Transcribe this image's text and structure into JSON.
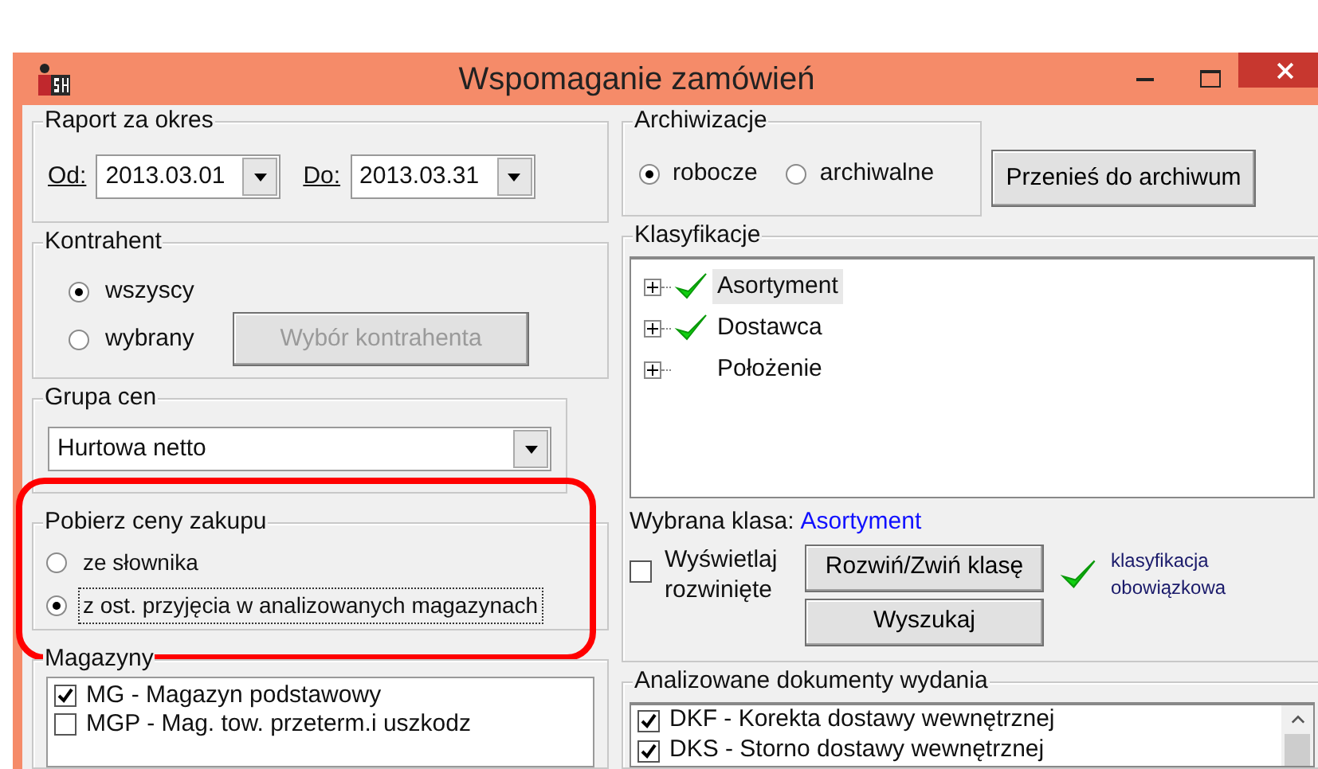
{
  "window": {
    "title": "Wspomaganie zamówień"
  },
  "report_period": {
    "title": "Raport za okres",
    "from_label": "Od:",
    "from_value": "2013.03.01",
    "to_label": "Do:",
    "to_value": "2013.03.31"
  },
  "contractor": {
    "title": "Kontrahent",
    "options": [
      {
        "label": "wszyscy",
        "selected": true
      },
      {
        "label": "wybrany",
        "selected": false
      }
    ],
    "button": {
      "label": "Wybór kontrahenta",
      "disabled": true
    }
  },
  "price_group": {
    "title": "Grupa cen",
    "value": "Hurtowa netto"
  },
  "purchase_prices": {
    "title": "Pobierz ceny zakupu",
    "highlighted": true,
    "options": [
      {
        "label": "ze słownika",
        "selected": false
      },
      {
        "label": "z ost. przyjęcia w analizowanych magazynach",
        "selected": true
      }
    ]
  },
  "warehouses": {
    "title": "Magazyny",
    "items": [
      {
        "label": "MG - Magazyn podstawowy",
        "checked": true
      },
      {
        "label": "MGP - Mag. tow. przeterm.i uszkodz",
        "checked": false
      }
    ]
  },
  "archives": {
    "title": "Archiwizacje",
    "options": [
      {
        "label": "robocze",
        "selected": true
      },
      {
        "label": "archiwalne",
        "selected": false
      }
    ],
    "button": "Przenieś do archiwum"
  },
  "classifications": {
    "title": "Klasyfikacje",
    "tree": [
      {
        "label": "Asortyment",
        "required": true,
        "selected": true
      },
      {
        "label": "Dostawca",
        "required": true,
        "selected": false
      },
      {
        "label": "Położenie",
        "required": false,
        "selected": false
      }
    ],
    "selected_class_label": "Wybrana klasa:",
    "selected_class_value": "Asortyment",
    "expand_checkbox": {
      "label": "Wyświetlaj rozwinięte",
      "checked": false
    },
    "toggle_button": "Rozwiń/Zwiń klasę",
    "search_button": "Wyszukaj",
    "legend_text": "klasyfikacja obowiązkowa"
  },
  "documents": {
    "title": "Analizowane dokumenty wydania",
    "items": [
      {
        "label": "DKF - Korekta dostawy wewnętrznej",
        "checked": true
      },
      {
        "label": "DKS - Storno dostawy wewnętrznej",
        "checked": true
      }
    ]
  }
}
